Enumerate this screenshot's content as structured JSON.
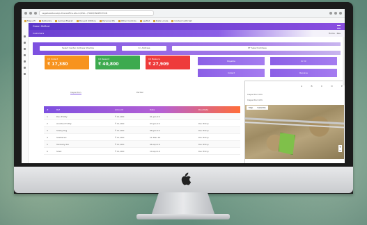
{
  "browser": {
    "url": "vegadeskdevelop.dhanaoffice.site.in/DSK.../FORM/INSPECTION",
    "bookmarks": [
      "Maps Pt",
      "Netbanks",
      "Gomes Bharat",
      "Prevent Ultiltory",
      "Personal DS",
      "Other Controls",
      "Leaflet",
      "Data Locals",
      "Content with Sat"
    ]
  },
  "app": {
    "topbar_title": "Green Shifted",
    "banner_title": "Customers",
    "banner_right": "Home · Res",
    "filters": {
      "select_1": "Select Center Address Shadow",
      "select_2": "Cr. Address",
      "select_3": "PT Select Address"
    },
    "cards": [
      {
        "label": "Int Collect",
        "value": "₹ 17,380",
        "color": "#f7931e"
      },
      {
        "label": "Int Reward",
        "value": "₹ 40,800",
        "color": "#3daa4f"
      },
      {
        "label": "Int Balance",
        "value": "₹ 27,909",
        "color": "#ee3b3b"
      }
    ],
    "panel_buttons": [
      "Payable",
      "Cr Dr",
      "Collect",
      "Receive"
    ],
    "tabs": [
      "Inspection",
      "Partial"
    ],
    "table": {
      "headers": [
        "#",
        "Ref",
        "Amount",
        "Date",
        "Due Date"
      ],
      "rows": [
        [
          "1",
          "Dev Entity",
          "₹ 11,000",
          "01-Jan-19",
          ""
        ],
        [
          "2",
          "Another Entity",
          "₹ 11,000",
          "03-Jan-19",
          "Dec Entry"
        ],
        [
          "3",
          "Shelly Dig",
          "₹ 11,000",
          "08-Jan-19",
          "Dec Entry"
        ],
        [
          "4",
          "Sheltered",
          "₹ 11,000",
          "11-Mar-19",
          "Dec Entry"
        ],
        [
          "5",
          "Tanbaby Rio",
          "₹ 11,000",
          "06-Apr-19",
          "Dec Entry"
        ],
        [
          "6",
          "Shell",
          "₹ 11,000",
          "19-Apr-19",
          "Dec Entry"
        ]
      ]
    },
    "map": {
      "info_line_1": "Inspection Info",
      "info_line_2": "Inspection Info",
      "cols": [
        "A",
        "B",
        "C",
        "D",
        "E"
      ],
      "tabs": [
        "Map",
        "Satellite"
      ],
      "zoom_in": "+",
      "zoom_out": "−"
    }
  }
}
